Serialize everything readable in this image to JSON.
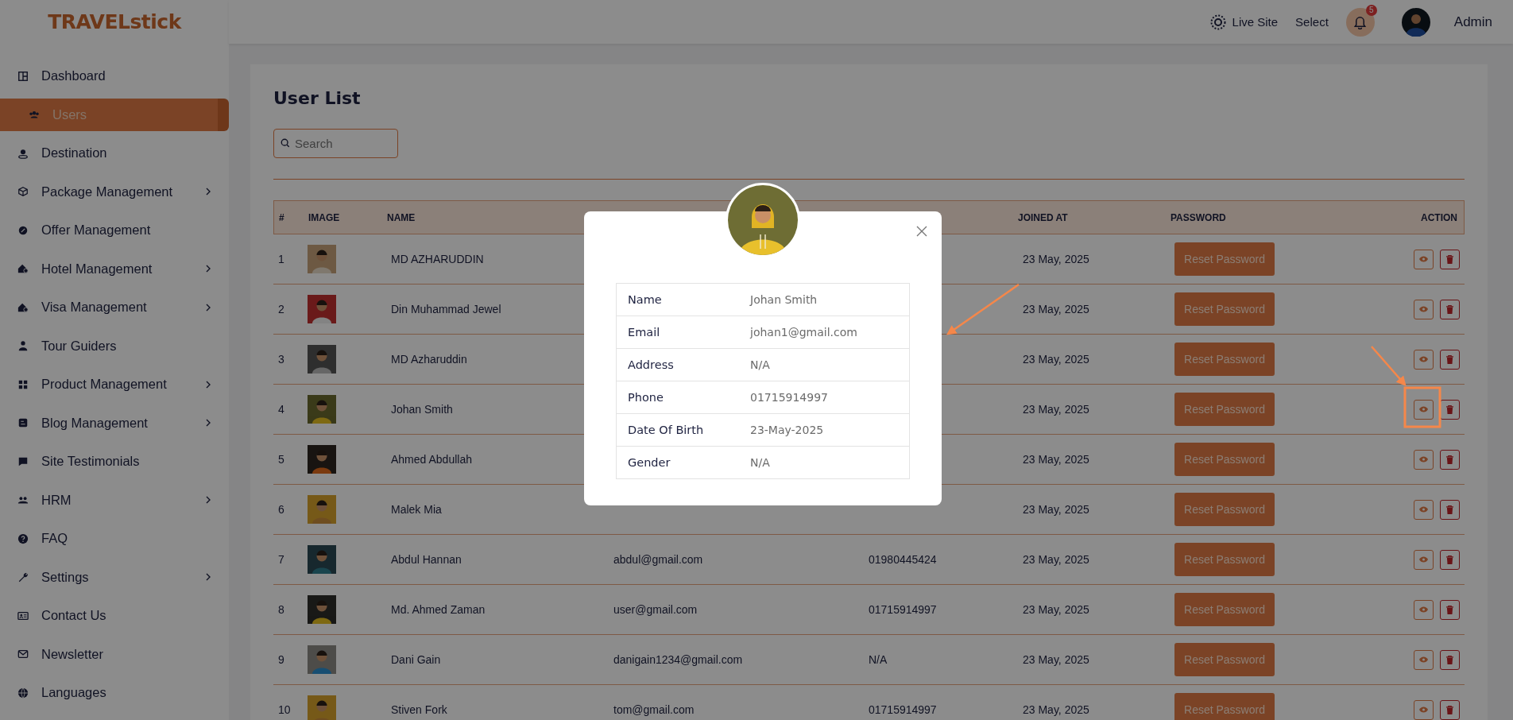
{
  "logo": {
    "text": "TRAVELstick"
  },
  "sidebar": {
    "items": [
      {
        "label": "Dashboard",
        "selected": false,
        "has_submenu": false
      },
      {
        "label": "Users",
        "selected": true,
        "has_submenu": false
      },
      {
        "label": "Destination",
        "selected": false,
        "has_submenu": false
      },
      {
        "label": "Package Management",
        "selected": false,
        "has_submenu": true
      },
      {
        "label": "Offer Management",
        "selected": false,
        "has_submenu": false
      },
      {
        "label": "Hotel Management",
        "selected": false,
        "has_submenu": true
      },
      {
        "label": "Visa Management",
        "selected": false,
        "has_submenu": true
      },
      {
        "label": "Tour Guiders",
        "selected": false,
        "has_submenu": false
      },
      {
        "label": "Product Management",
        "selected": false,
        "has_submenu": true
      },
      {
        "label": "Blog Management",
        "selected": false,
        "has_submenu": true
      },
      {
        "label": "Site Testimonials",
        "selected": false,
        "has_submenu": false
      },
      {
        "label": "HRM",
        "selected": false,
        "has_submenu": true
      },
      {
        "label": "FAQ",
        "selected": false,
        "has_submenu": false
      },
      {
        "label": "Settings",
        "selected": false,
        "has_submenu": true
      },
      {
        "label": "Contact Us",
        "selected": false,
        "has_submenu": false
      },
      {
        "label": "Newsletter",
        "selected": false,
        "has_submenu": false
      },
      {
        "label": "Languages",
        "selected": false,
        "has_submenu": false
      }
    ]
  },
  "header": {
    "live_site": "Live Site",
    "select": "Select",
    "notification_count": "5",
    "user": "Admin"
  },
  "page": {
    "title": "User List",
    "search": {
      "placeholder": "Search"
    }
  },
  "table": {
    "columns": {
      "number": "#",
      "image": "IMAGE",
      "name": "NAME",
      "joined_at": "JOINED AT",
      "password": "PASSWORD",
      "action": "ACTION"
    },
    "rows": [
      {
        "number": "1",
        "name": "MD AZHARUDDIN",
        "joined_at": "23 May, 2025",
        "reset": "Reset Password"
      },
      {
        "number": "2",
        "name": "Din Muhammad Jewel",
        "joined_at": "23 May, 2025",
        "reset": "Reset Password"
      },
      {
        "number": "3",
        "name": "MD Azharuddin",
        "joined_at": "23 May, 2025",
        "reset": "Reset Password"
      },
      {
        "number": "4",
        "name": "Johan Smith",
        "joined_at": "23 May, 2025",
        "reset": "Reset Password"
      },
      {
        "number": "5",
        "name": "Ahmed Abdullah",
        "joined_at": "23 May, 2025",
        "reset": "Reset Password"
      },
      {
        "number": "6",
        "name": "Malek Mia",
        "joined_at": "23 May, 2025",
        "reset": "Reset Password"
      },
      {
        "number": "7",
        "name": "Abdul Hannan",
        "email": "abdul@gmail.com",
        "phone": "01980445424",
        "joined_at": "23 May, 2025",
        "reset": "Reset Password"
      },
      {
        "number": "8",
        "name": "Md. Ahmed Zaman",
        "email": "user@gmail.com",
        "phone": "01715914997",
        "joined_at": "23 May, 2025",
        "reset": "Reset Password"
      },
      {
        "number": "9",
        "name": "Dani Gain",
        "email": "danigain1234@gmail.com",
        "phone": "N/A",
        "joined_at": "23 May, 2025",
        "reset": "Reset Password"
      },
      {
        "number": "10",
        "name": "Stiven Fork",
        "email": "tom@gmail.com",
        "phone": "01715914997",
        "joined_at": "23 May, 2025",
        "reset": "Reset Password"
      }
    ]
  },
  "modal": {
    "details": [
      {
        "label": "Name",
        "value": "Johan Smith"
      },
      {
        "label": "Email",
        "value": "johan1@gmail.com"
      },
      {
        "label": "Address",
        "value": "N/A"
      },
      {
        "label": "Phone",
        "value": "01715914997"
      },
      {
        "label": "Date Of Birth",
        "value": "23-May-2025"
      },
      {
        "label": "Gender",
        "value": "N/A"
      }
    ]
  }
}
